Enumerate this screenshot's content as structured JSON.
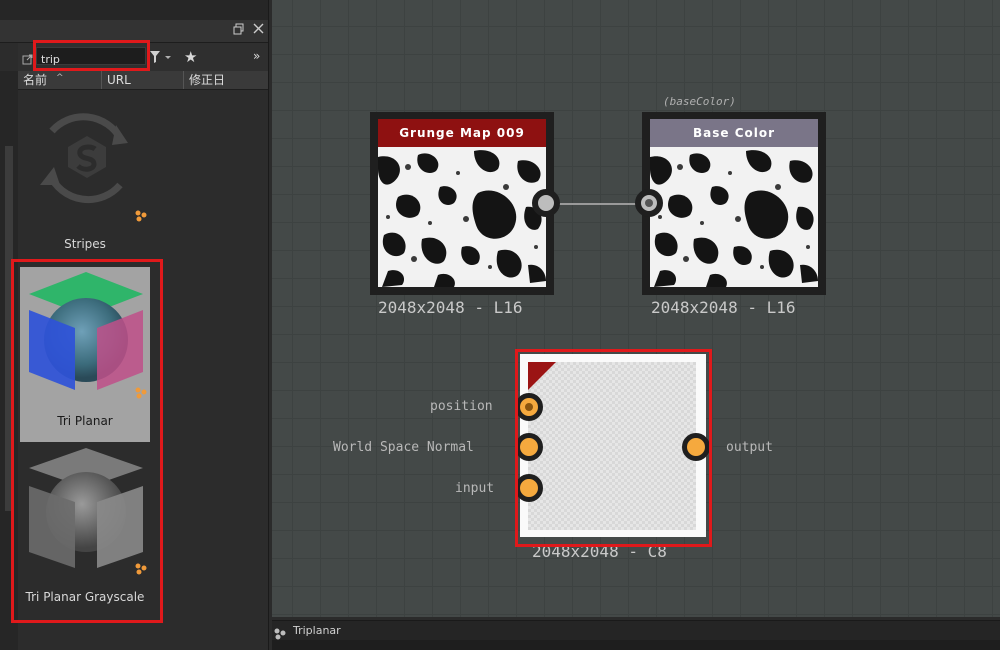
{
  "library": {
    "search_value": "trip",
    "columns": [
      {
        "label": "名前"
      },
      {
        "label": "URL"
      },
      {
        "label": "修正日"
      }
    ],
    "items": [
      {
        "label": "Stripes"
      },
      {
        "label": "Tri Planar"
      },
      {
        "label": "Tri Planar Grayscale"
      }
    ]
  },
  "graph": {
    "nodes": [
      {
        "title": "Grunge Map 009",
        "resolution": "2048x2048 - L16",
        "header_color": "#8e1111"
      },
      {
        "title": "Base Color",
        "resolution": "2048x2048 - L16",
        "header_color": "#7a7588",
        "annotation": "(baseColor)"
      },
      {
        "title": "",
        "resolution": "2048x2048 - C8",
        "inputs": [
          "position",
          "World Space Normal",
          "input"
        ],
        "outputs": [
          "output"
        ]
      }
    ]
  },
  "status_bar": {
    "label": "Triplanar"
  },
  "colors": {
    "accent_red": "#e0191b",
    "port_orange": "#f5a93e",
    "canvas": "#444948"
  },
  "icons": [
    "restore-window-icon",
    "close-icon",
    "open-external-icon",
    "filter-icon",
    "star-icon",
    "expand-icon",
    "substance-logo-icon",
    "node-graph-badge-icon",
    "graph-tab-icon"
  ]
}
